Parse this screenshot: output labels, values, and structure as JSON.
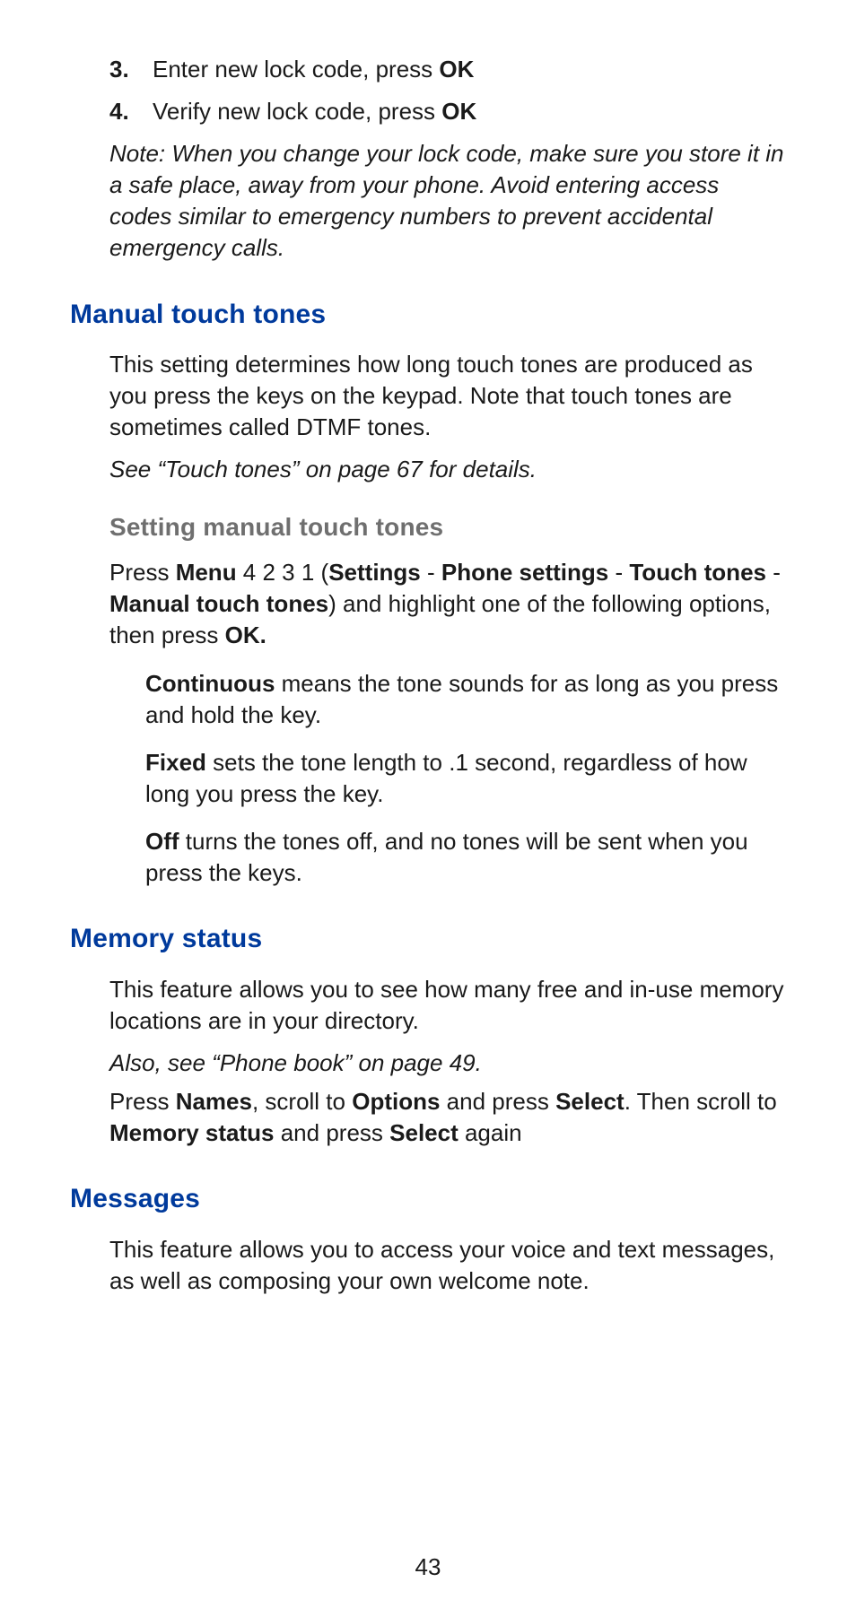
{
  "steps": [
    {
      "num": "3.",
      "pre": "Enter new lock code, press ",
      "bold": "OK"
    },
    {
      "num": "4.",
      "pre": "Verify new lock code, press ",
      "bold": "OK"
    }
  ],
  "lock_note": "Note: When you change your lock code, make sure you store it in a safe place, away from your phone. Avoid entering access codes similar to emergency numbers to prevent accidental emergency calls.",
  "manual": {
    "heading": "Manual touch tones",
    "intro": "This setting determines how long touch tones are produced as you press the keys on the keypad. Note that touch tones are sometimes called DTMF tones.",
    "see": "See “Touch tones” on page 67 for details.",
    "sub_heading": "Setting manual touch tones",
    "press": {
      "p1": "Press ",
      "b_menu": "Menu",
      "p2": " 4 2 3 1 (",
      "b_settings": "Settings",
      "dash1": " - ",
      "b_phone": "Phone settings",
      "dash2": " - ",
      "b_touch": "Touch tones",
      "dash3": " - ",
      "b_manual": "Manual touch tones",
      "p3": ") and highlight one of the following options, then press ",
      "b_ok": "OK."
    },
    "opts": {
      "cont_b": "Continuous",
      "cont_t": " means the tone sounds for as long as you press and hold the key.",
      "fixed_b": "Fixed",
      "fixed_t": " sets the tone length to .1 second, regardless of how long you press the key.",
      "off_b": "Off",
      "off_t": " turns the tones off, and no tones will be sent when you press the keys."
    }
  },
  "memory": {
    "heading": "Memory status",
    "intro": "This feature allows you to see how many free and in-use memory locations are in your directory.",
    "see": "Also, see “Phone book” on page 49.",
    "press": {
      "p1": "Press ",
      "b_names": "Names",
      "p2": ", scroll to ",
      "b_options": "Options",
      "p3": " and press ",
      "b_select1": "Select",
      "p4": ". Then scroll to ",
      "b_memstatus": "Memory status",
      "p5": " and press ",
      "b_select2": "Select",
      "p6": " again"
    }
  },
  "messages": {
    "heading": "Messages",
    "intro": "This feature allows you to access your voice and text messages, as well as composing your own welcome note."
  },
  "page_number": "43"
}
